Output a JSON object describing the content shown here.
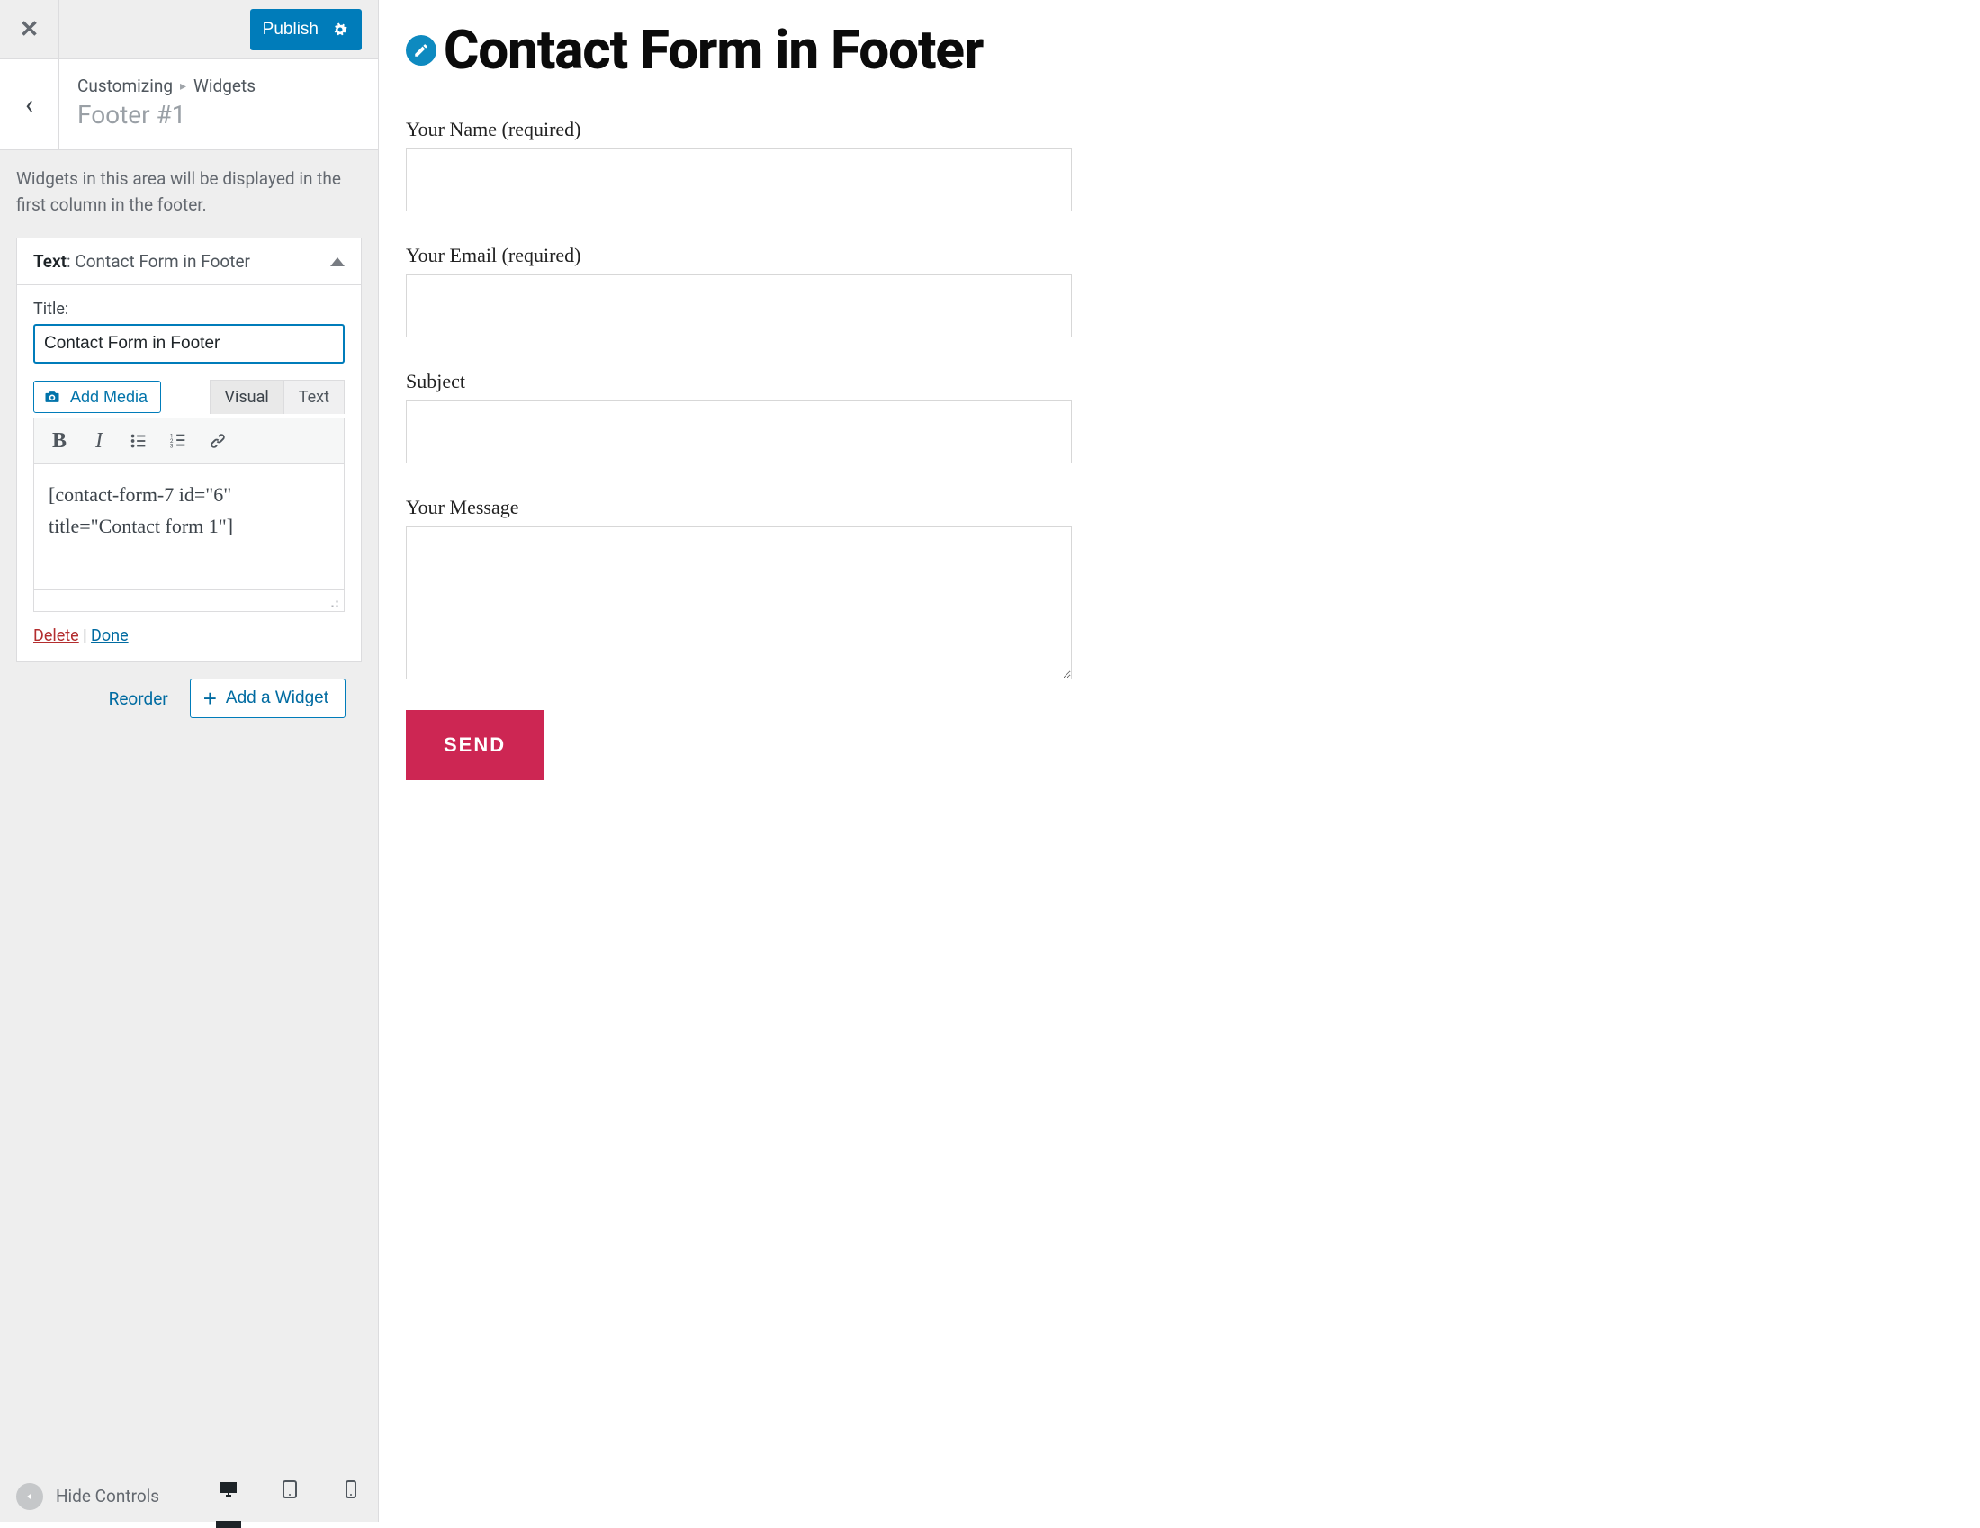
{
  "toolbar": {
    "publish": "Publish"
  },
  "crumb": {
    "customizing": "Customizing",
    "breadcrumb_item": "Widgets",
    "section_title": "Footer #1"
  },
  "sidebar_description": "Widgets in this area will be displayed in the first column in the footer.",
  "widget": {
    "type_label": "Text",
    "name": "Contact Form in Footer",
    "title_label": "Title:",
    "title_value": "Contact Form in Footer",
    "add_media": "Add Media",
    "tabs": {
      "visual": "Visual",
      "text": "Text"
    },
    "content": "[contact-form-7 id=\"6\" title=\"Contact form 1\"]",
    "delete": "Delete",
    "done": "Done"
  },
  "actions": {
    "reorder": "Reorder",
    "add_widget": "Add a Widget"
  },
  "footer": {
    "hide_controls": "Hide Controls"
  },
  "preview": {
    "heading": "Contact Form in Footer",
    "your_name": "Your Name (required)",
    "your_email": "Your Email (required)",
    "subject": "Subject",
    "your_message": "Your Message",
    "send": "SEND"
  },
  "colors": {
    "primary": "#007cba",
    "accent": "#cd2653"
  }
}
